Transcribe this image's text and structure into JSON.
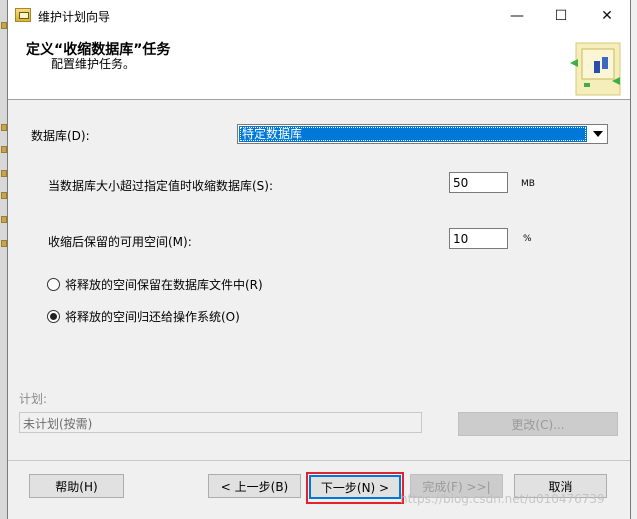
{
  "window": {
    "title": "维护计划向导",
    "minimize_glyph": "—",
    "maximize_glyph": "☐",
    "close_glyph": "✕"
  },
  "header": {
    "title": "定义“收缩数据库”任务",
    "subtitle": "配置维护任务。"
  },
  "form": {
    "database_label": "数据库(D):",
    "database_value": "特定数据库",
    "shrink_threshold_label": "当数据库大小超过指定值时收缩数据库(S):",
    "shrink_threshold_value": "50",
    "shrink_threshold_unit": "MB",
    "free_space_label": "收缩后保留的可用空间(M):",
    "free_space_value": "10",
    "free_space_unit": "%",
    "radio_options": [
      {
        "label": "将释放的空间保留在数据库文件中(R)",
        "checked": false
      },
      {
        "label": "将释放的空间归还给操作系统(O)",
        "checked": true
      }
    ]
  },
  "schedule": {
    "label": "计划:",
    "value": "未计划(按需)",
    "change_button": "更改(C)..."
  },
  "footer": {
    "help_button": "帮助(H)",
    "back_button": "< 上一步(B)",
    "next_button": "下一步(N) >",
    "finish_button": "完成(F) >>|",
    "cancel_button": "取消"
  },
  "watermark": "https://blog.csdn.net/u010476739",
  "colors": {
    "selection": "#0078d7",
    "highlight_box": "#e0232f",
    "dialog_bg": "#f0f0f0"
  }
}
